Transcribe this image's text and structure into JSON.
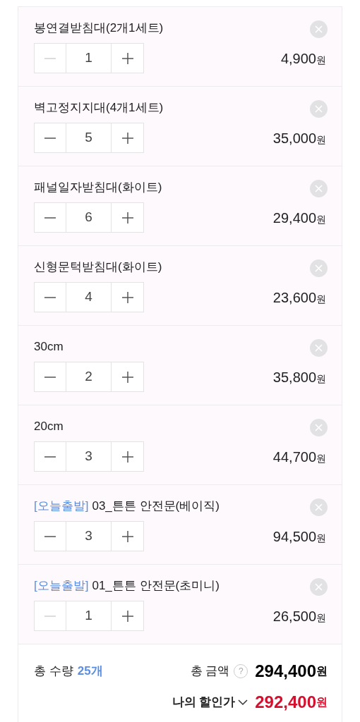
{
  "items": [
    {
      "name": "봉연결받침대(2개1세트)",
      "quantity": "1",
      "minus_disabled": true,
      "price": "4,900",
      "unit": "원"
    },
    {
      "name": "벽고정지지대(4개1세트)",
      "quantity": "5",
      "minus_disabled": false,
      "price": "35,000",
      "unit": "원"
    },
    {
      "name": "패널일자받침대(화이트)",
      "quantity": "6",
      "minus_disabled": false,
      "price": "29,400",
      "unit": "원"
    },
    {
      "name": "신형문턱받침대(화이트)",
      "quantity": "4",
      "minus_disabled": false,
      "price": "23,600",
      "unit": "원"
    },
    {
      "name": "30cm",
      "quantity": "2",
      "minus_disabled": false,
      "price": "35,800",
      "unit": "원"
    },
    {
      "name": "20cm",
      "quantity": "3",
      "minus_disabled": false,
      "price": "44,700",
      "unit": "원"
    },
    {
      "tag": "[오늘출발]",
      "name": "03_튼튼 안전문(베이직)",
      "quantity": "3",
      "minus_disabled": false,
      "price": "94,500",
      "unit": "원"
    },
    {
      "tag": "[오늘출발]",
      "name": "01_튼튼 안전문(초미니)",
      "quantity": "1",
      "minus_disabled": true,
      "price": "26,500",
      "unit": "원"
    }
  ],
  "summary": {
    "quantity_label": "총 수량",
    "quantity_value": "25개",
    "total_label": "총 금액",
    "total_help": "?",
    "total_price": "294,400",
    "total_unit": "원",
    "discount_label": "나의 할인가",
    "discount_price": "292,400",
    "discount_unit": "원"
  }
}
